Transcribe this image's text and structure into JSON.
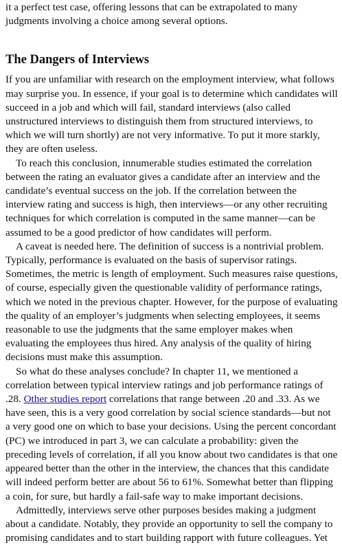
{
  "document": {
    "intro_paragraph": "it a perfect test case, offering lessons that can be extrapolated to many judgments involving a choice among several options.",
    "section_heading": "The Dangers of Interviews",
    "paragraphs": [
      "If you are unfamiliar with research on the employment interview, what follows may surprise you. In essence, if your goal is to determine which candidates will succeed in a job and which will fail, standard interviews (also called unstructured interviews to distinguish them from structured interviews, to which we will turn shortly) are not very informative. To put it more starkly, they are often useless.",
      "To reach this conclusion, innumerable studies estimated the correlation between the rating an evaluator gives a candidate after an interview and the candidate’s eventual success on the job. If the correlation between the interview rating and success is high, then interviews—or any other recruiting techniques for which correlation is computed in the same manner—can be assumed to be a good predictor of how candidates will perform.",
      "A caveat is needed here. The definition of success is a nontrivial problem. Typically, performance is evaluated on the basis of supervisor ratings. Sometimes, the metric is length of employment. Such measures raise questions, of course, especially given the questionable validity of performance ratings, which we noted in the previous chapter. However, for the purpose of evaluating the quality of an employer’s judgments when selecting employees, it seems reasonable to use the judgments that the same employer makes when evaluating the employees thus hired. Any analysis of the quality of hiring decisions must make this assumption."
    ],
    "paragraph_4": {
      "before_link": "So what do these analyses conclude? In chapter 11, we mentioned a correlation between typical interview ratings and job performance ratings of .28. ",
      "link_text": "Other studies report",
      "after_link": " correlations that range between .20 and .33. As we have seen, this is a very good correlation by social science standards—but not a very good one on which to base your decisions. Using the percent concordant (PC) we introduced in part 3, we can calculate a probability: given the preceding levels of correlation, if all you know about two candidates is that one appeared better than the other in the interview, the chances that this candidate will indeed perform better are about 56 to 61%. Somewhat better than flipping a coin, for sure, but hardly a fail-safe way to make important decisions."
    },
    "last_paragraph": "Admittedly, interviews serve other purposes besides making a judgment about a candidate. Notably, they provide an opportunity to sell the company to promising candidates and to start building rapport with future colleagues. Yet"
  }
}
